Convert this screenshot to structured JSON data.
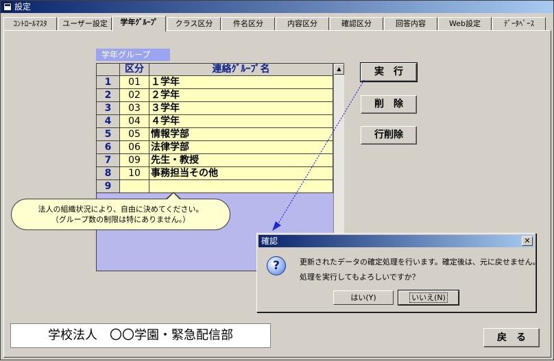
{
  "window": {
    "title": "設定"
  },
  "tabs": [
    {
      "label": "ｺﾝﾄﾛｰﾙﾏｽﾀ"
    },
    {
      "label": "ユーザー設定"
    },
    {
      "label": "学年ｸﾞﾙｰﾌﾟ"
    },
    {
      "label": "クラス区分"
    },
    {
      "label": "件名区分"
    },
    {
      "label": "内容区分"
    },
    {
      "label": "確認区分"
    },
    {
      "label": "回答内容"
    },
    {
      "label": "Web設定"
    },
    {
      "label": "ﾃﾞｰﾀﾍﾞｰｽ"
    }
  ],
  "active_tab": "学年ｸﾞﾙｰﾌﾟ",
  "section_label": "学年グループ",
  "grid": {
    "headers": {
      "code": "区分",
      "name": "連絡ｸﾞﾙｰﾌﾟ名"
    },
    "rows": [
      {
        "num": "1",
        "code": "01",
        "name": "１学年"
      },
      {
        "num": "2",
        "code": "02",
        "name": "２学年"
      },
      {
        "num": "3",
        "code": "03",
        "name": "３学年"
      },
      {
        "num": "4",
        "code": "04",
        "name": "４学年"
      },
      {
        "num": "5",
        "code": "05",
        "name": "情報学部"
      },
      {
        "num": "6",
        "code": "06",
        "name": "法律学部"
      },
      {
        "num": "7",
        "code": "09",
        "name": "先生・教授"
      },
      {
        "num": "8",
        "code": "10",
        "name": "事務担当その他"
      },
      {
        "num": "9",
        "code": "",
        "name": ""
      }
    ]
  },
  "buttons": {
    "execute": "実　行",
    "delete": "削　除",
    "row_delete": "行削除",
    "back": "戻　る"
  },
  "callout": {
    "line1": "法人の組織状況により、自由に決めてください。",
    "line2": "（グループ数の制限は特にありません。）"
  },
  "footer": {
    "org_name": "学校法人　〇〇学園・緊急配信部"
  },
  "dialog": {
    "title": "確認",
    "message1": "更新されたデータの確定処理を行います。確定後は、元に戻せません。",
    "message2": "処理を実行してもよろしいですか？",
    "yes": "はい(Y)",
    "no": "いいえ(N)"
  }
}
